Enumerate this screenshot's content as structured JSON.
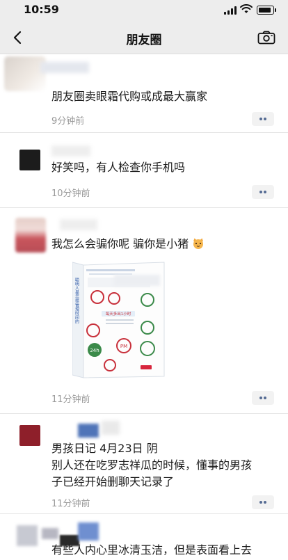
{
  "status_bar": {
    "time": "10:59"
  },
  "nav": {
    "title": "朋友圈",
    "back_icon": "back-chevron-icon",
    "camera_icon": "camera-icon"
  },
  "messages": [
    {
      "text": "朋友圈卖眼霜代购或成最大赢家",
      "time": "9分钟前"
    },
    {
      "text": "好笑吗，有人检查你手机吗",
      "time": "10分钟前"
    },
    {
      "text": "我怎么会骗你呢 骗你是小猪",
      "time": "11分钟前",
      "image": "book-cover"
    },
    {
      "text_line1": "男孩日记 4月23日 阴",
      "text_line2": "别人还在吃罗志祥瓜的时候，懂事的男孩",
      "text_line3": "子已经开始删聊天记录了",
      "time": "11分钟前"
    },
    {
      "text": "有些人内心里冰清玉洁，但是表面看上去"
    }
  ],
  "book": {
    "banner_text": "每天多出1小时",
    "badge_24h": "24h",
    "badge_pm": "PM"
  },
  "colors": {
    "link_blue": "#556b93",
    "time_gray": "#9a9a9a",
    "header_bg": "#ededed"
  }
}
